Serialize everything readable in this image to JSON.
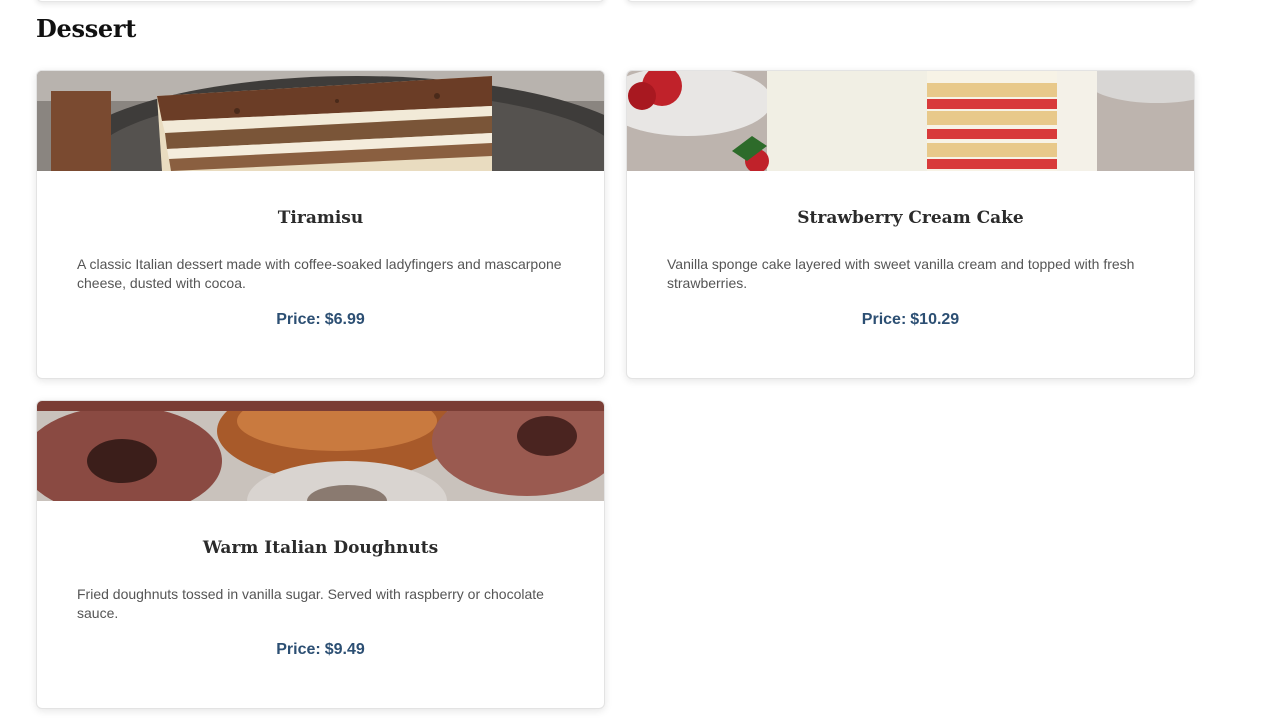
{
  "section": {
    "title": "Dessert"
  },
  "colors": {
    "price": "#2c4f73",
    "title": "#2b2b2b",
    "description": "#555555"
  },
  "items": [
    {
      "name": "Tiramisu",
      "description": "A classic Italian dessert made with coffee-soaked ladyfingers and mascarpone cheese, dusted with cocoa.",
      "price_label": "Price:",
      "price": "$6.99",
      "image": "tiramisu-photo"
    },
    {
      "name": "Strawberry Cream Cake",
      "description": "Vanilla sponge cake layered with sweet vanilla cream and topped with fresh strawberries.",
      "price_label": "Price:",
      "price": "$10.29",
      "image": "strawberry-cake-photo"
    },
    {
      "name": "Warm Italian Doughnuts",
      "description": "Fried doughnuts tossed in vanilla sugar. Served with raspberry or chocolate sauce.",
      "price_label": "Price:",
      "price": "$9.49",
      "image": "doughnuts-photo"
    }
  ]
}
